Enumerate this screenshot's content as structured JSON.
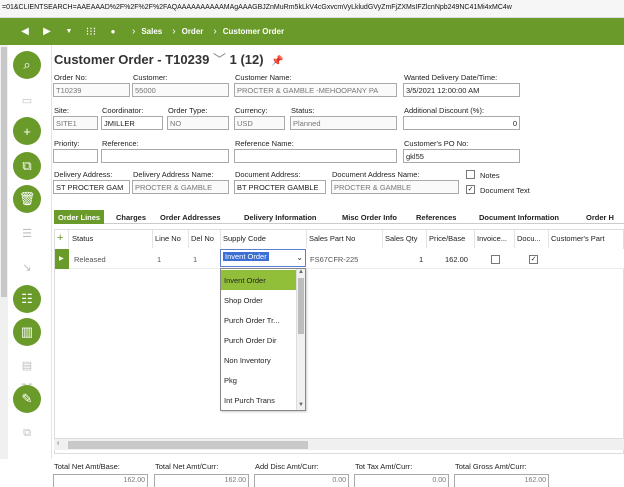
{
  "browser": {
    "url": "=01&CLIENTSEARCH=AAEAAAD%2F%2F%2F%2FAQAAAAAAAAAAMAgAAAGBJZnMuRm5kLkV4cGxvcmVyLkludGVyZmFjZXMsIFZlcnNpb249NC41Mi4xMC4w"
  },
  "navbar": {
    "crumbs": [
      "Sales",
      "Order",
      "Customer Order"
    ]
  },
  "header": {
    "title": "Customer Order - T10239",
    "record": "1 (12)"
  },
  "form": {
    "order_no_label": "Order No:",
    "order_no": "T10239",
    "customer_label": "Customer:",
    "customer": "55000",
    "customer_name_label": "Customer Name:",
    "customer_name": "PROCTER & GAMBLE -MEHOOPANY PA",
    "wanted_label": "Wanted Delivery Date/Time:",
    "wanted": "3/5/2021 12:00:00 AM",
    "site_label": "Site:",
    "site": "SITE1",
    "coordinator_label": "Coordinator:",
    "coordinator": "JMILLER",
    "order_type_label": "Order Type:",
    "order_type": "NO",
    "currency_label": "Currency:",
    "currency": "USD",
    "status_label": "Status:",
    "status": "Planned",
    "add_discount_label": "Additional Discount (%):",
    "add_discount": "0",
    "priority_label": "Priority:",
    "priority": "",
    "reference_label": "Reference:",
    "reference": "",
    "ref_name_label": "Reference Name:",
    "ref_name": "",
    "cust_po_label": "Customer's PO No:",
    "cust_po": "gkl55",
    "delivery_address_label": "Delivery Address:",
    "delivery_address": "ST PROCTER  GAM",
    "delivery_address_name_label": "Delivery Address Name:",
    "delivery_address_name": "PROCTER & GAMBLE",
    "document_address_label": "Document Address:",
    "document_address": "BT PROCTER  GAMBLE",
    "document_address_name_label": "Document Address Name:",
    "document_address_name": "PROCTER & GAMBLE",
    "notes_label": "Notes",
    "document_text_label": "Document Text",
    "document_text_check": "✓"
  },
  "tabs": [
    "Order Lines",
    "Charges",
    "Order Addresses",
    "Delivery Information",
    "Misc Order Info",
    "References",
    "Document Information",
    "Order H"
  ],
  "grid": {
    "columns": [
      "Status",
      "Line No",
      "Del No",
      "Supply Code",
      "Sales Part No",
      "Sales Qty",
      "Price/Base",
      "Invoice...",
      "Docu...",
      "Customer's Part"
    ],
    "row": {
      "status": "Released",
      "line_no": "1",
      "del_no": "1",
      "supply_code": "Invent Order",
      "sales_part_no": "FS67CFR-225",
      "sales_qty": "1",
      "price_base": "162.00",
      "docu_check": "✓"
    },
    "supply_code_options": [
      "Invent Order",
      "Shop Order",
      "Purch Order Tr...",
      "Purch Order Dir",
      "Non Inventory",
      "Pkg",
      "Int Purch Trans"
    ]
  },
  "footer": {
    "labels": [
      "Total Net Amt/Base:",
      "Total Net Amt/Curr:",
      "Add Disc Amt/Curr:",
      "Tot Tax Amt/Curr:",
      "Total Gross Amt/Curr:"
    ],
    "values": [
      "162.00",
      "162.00",
      "0.00",
      "0.00",
      "162.00"
    ]
  },
  "colors": {
    "accent": "#6a9b2a",
    "selected_option": "#92bf3a"
  }
}
